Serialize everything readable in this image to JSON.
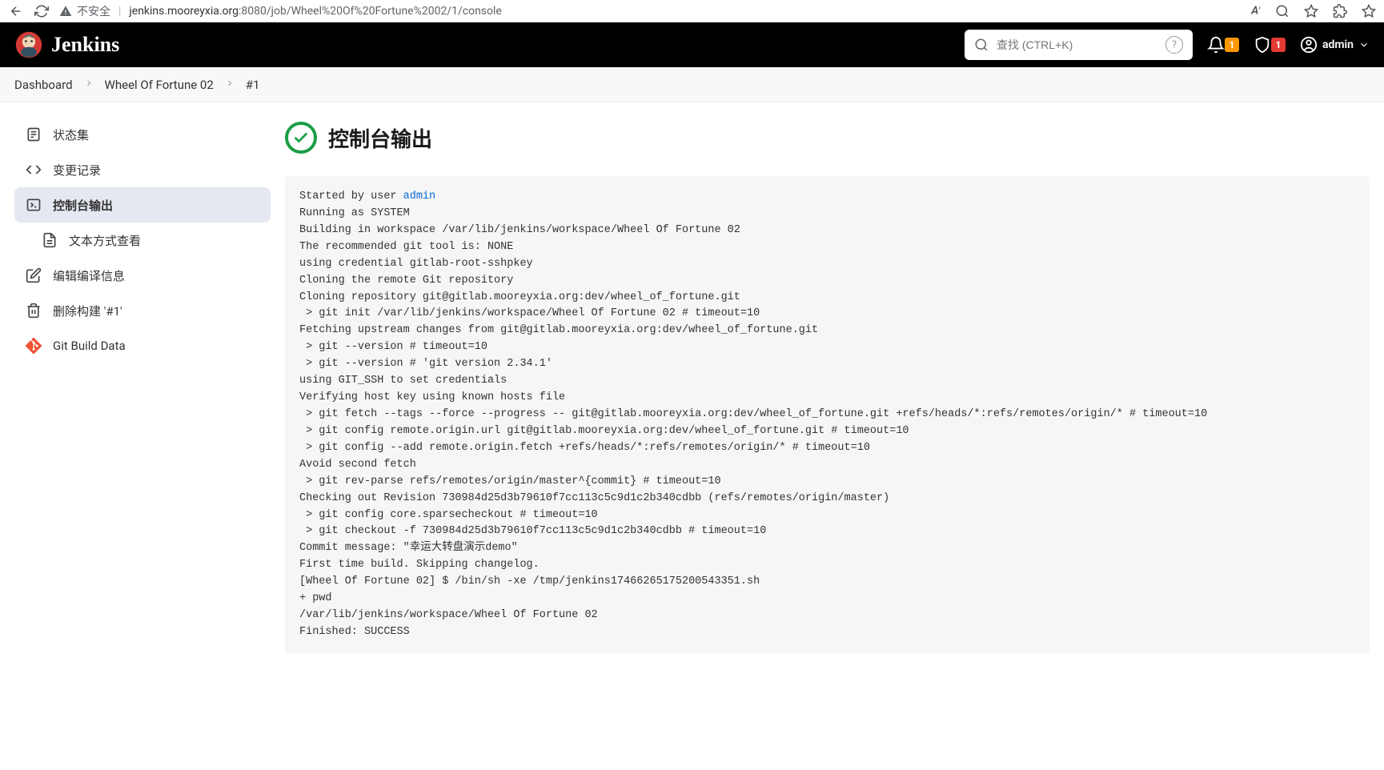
{
  "browser": {
    "not_secure": "不安全",
    "url_host": "jenkins.mooreyxia.org",
    "url_rest": ":8080/job/Wheel%20Of%20Fortune%2002/1/console"
  },
  "header": {
    "brand": "Jenkins",
    "search_placeholder": "查找 (CTRL+K)",
    "notif_count": "1",
    "security_count": "1",
    "user": "admin"
  },
  "breadcrumb": {
    "items": [
      "Dashboard",
      "Wheel Of Fortune 02",
      "#1"
    ]
  },
  "sidebar": {
    "items": [
      {
        "label": "状态集"
      },
      {
        "label": "变更记录"
      },
      {
        "label": "控制台输出"
      },
      {
        "label": "文本方式查看"
      },
      {
        "label": "编辑编译信息"
      },
      {
        "label": "删除构建 '#1'"
      },
      {
        "label": "Git Build Data"
      }
    ]
  },
  "page": {
    "title": "控制台输出"
  },
  "console": {
    "prefix": "Started by user ",
    "user_link": "admin",
    "body": "\nRunning as SYSTEM\nBuilding in workspace /var/lib/jenkins/workspace/Wheel Of Fortune 02\nThe recommended git tool is: NONE\nusing credential gitlab-root-sshpkey\nCloning the remote Git repository\nCloning repository git@gitlab.mooreyxia.org:dev/wheel_of_fortune.git\n > git init /var/lib/jenkins/workspace/Wheel Of Fortune 02 # timeout=10\nFetching upstream changes from git@gitlab.mooreyxia.org:dev/wheel_of_fortune.git\n > git --version # timeout=10\n > git --version # 'git version 2.34.1'\nusing GIT_SSH to set credentials \nVerifying host key using known hosts file\n > git fetch --tags --force --progress -- git@gitlab.mooreyxia.org:dev/wheel_of_fortune.git +refs/heads/*:refs/remotes/origin/* # timeout=10\n > git config remote.origin.url git@gitlab.mooreyxia.org:dev/wheel_of_fortune.git # timeout=10\n > git config --add remote.origin.fetch +refs/heads/*:refs/remotes/origin/* # timeout=10\nAvoid second fetch\n > git rev-parse refs/remotes/origin/master^{commit} # timeout=10\nChecking out Revision 730984d25d3b79610f7cc113c5c9d1c2b340cdbb (refs/remotes/origin/master)\n > git config core.sparsecheckout # timeout=10\n > git checkout -f 730984d25d3b79610f7cc113c5c9d1c2b340cdbb # timeout=10\nCommit message: \"幸运大转盘演示demo\"\nFirst time build. Skipping changelog.\n[Wheel Of Fortune 02] $ /bin/sh -xe /tmp/jenkins17466265175200543351.sh\n+ pwd\n/var/lib/jenkins/workspace/Wheel Of Fortune 02\nFinished: SUCCESS"
  }
}
